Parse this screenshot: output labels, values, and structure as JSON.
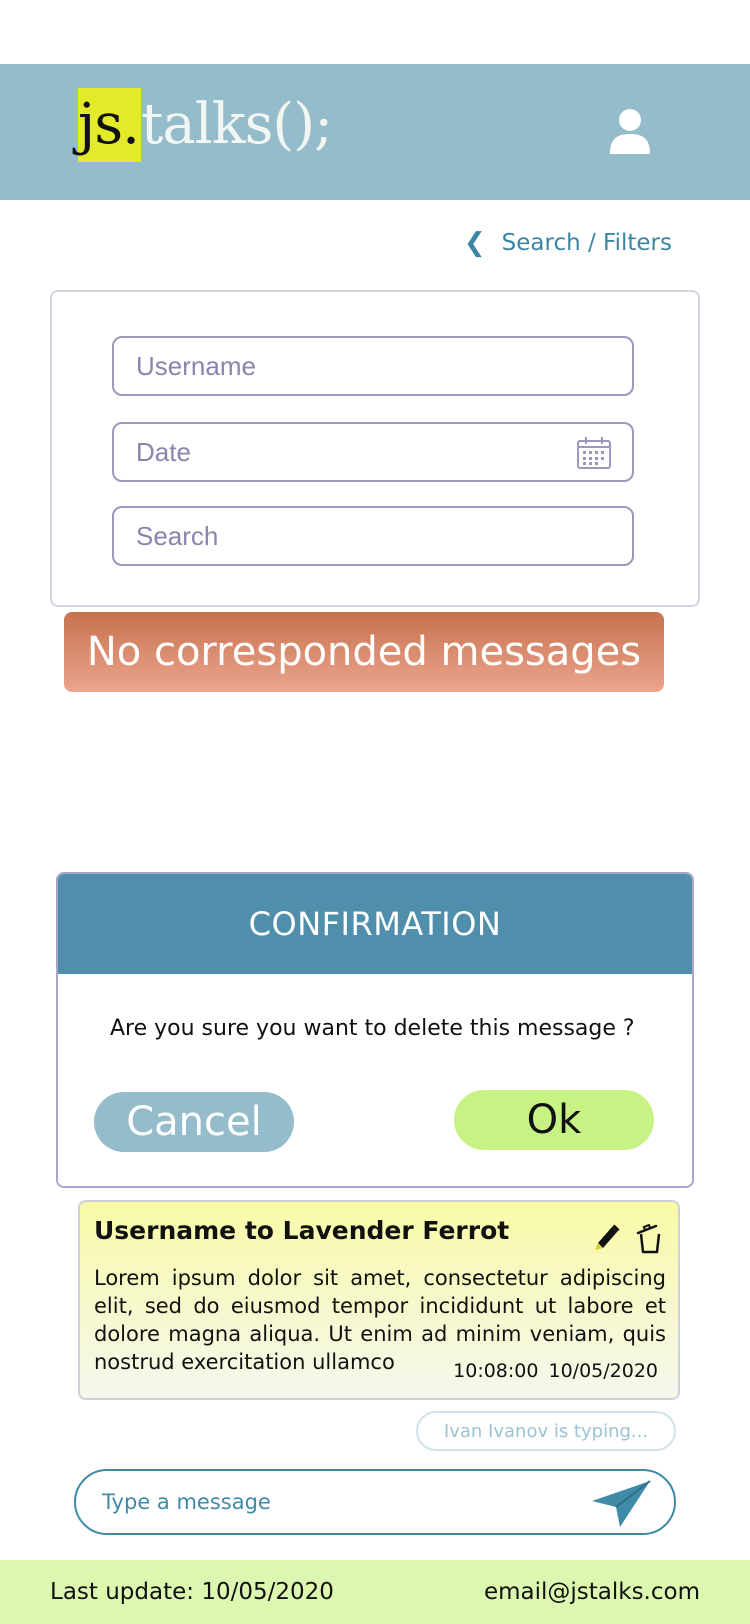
{
  "header": {
    "logo_js": "js.",
    "logo_rest": "talks();"
  },
  "filters": {
    "link_label": "Search / Filters",
    "username_placeholder": "Username",
    "date_placeholder": "Date",
    "search_placeholder": "Search"
  },
  "alert": {
    "text": "No corresponded messages"
  },
  "dialog": {
    "title": "CONFIRMATION",
    "question": "Are you sure you want to delete this message ?",
    "cancel_label": "Cancel",
    "ok_label": "Ok"
  },
  "message": {
    "title": "Username to Lavender Ferrot",
    "body": "Lorem ipsum dolor sit amet, consectetur adipiscing elit, sed do eiusmod tempor incididunt ut labore et dolore magna aliqua. Ut enim ad minim veniam, quis nostrud exercitation ullamco",
    "time": "10:08:00",
    "date": "10/05/2020"
  },
  "typing_indicator": "Ivan Ivanov is typing...",
  "composer": {
    "placeholder": "Type a message"
  },
  "footer": {
    "last_update": "Last update: 10/05/2020",
    "email": "email@jstalks.com"
  },
  "colors": {
    "header_bg": "#95bccb",
    "accent": "#4f8fab",
    "alert": "#c6724d",
    "ok": "#c7f385",
    "footer_bg": "#dcf7b0"
  }
}
